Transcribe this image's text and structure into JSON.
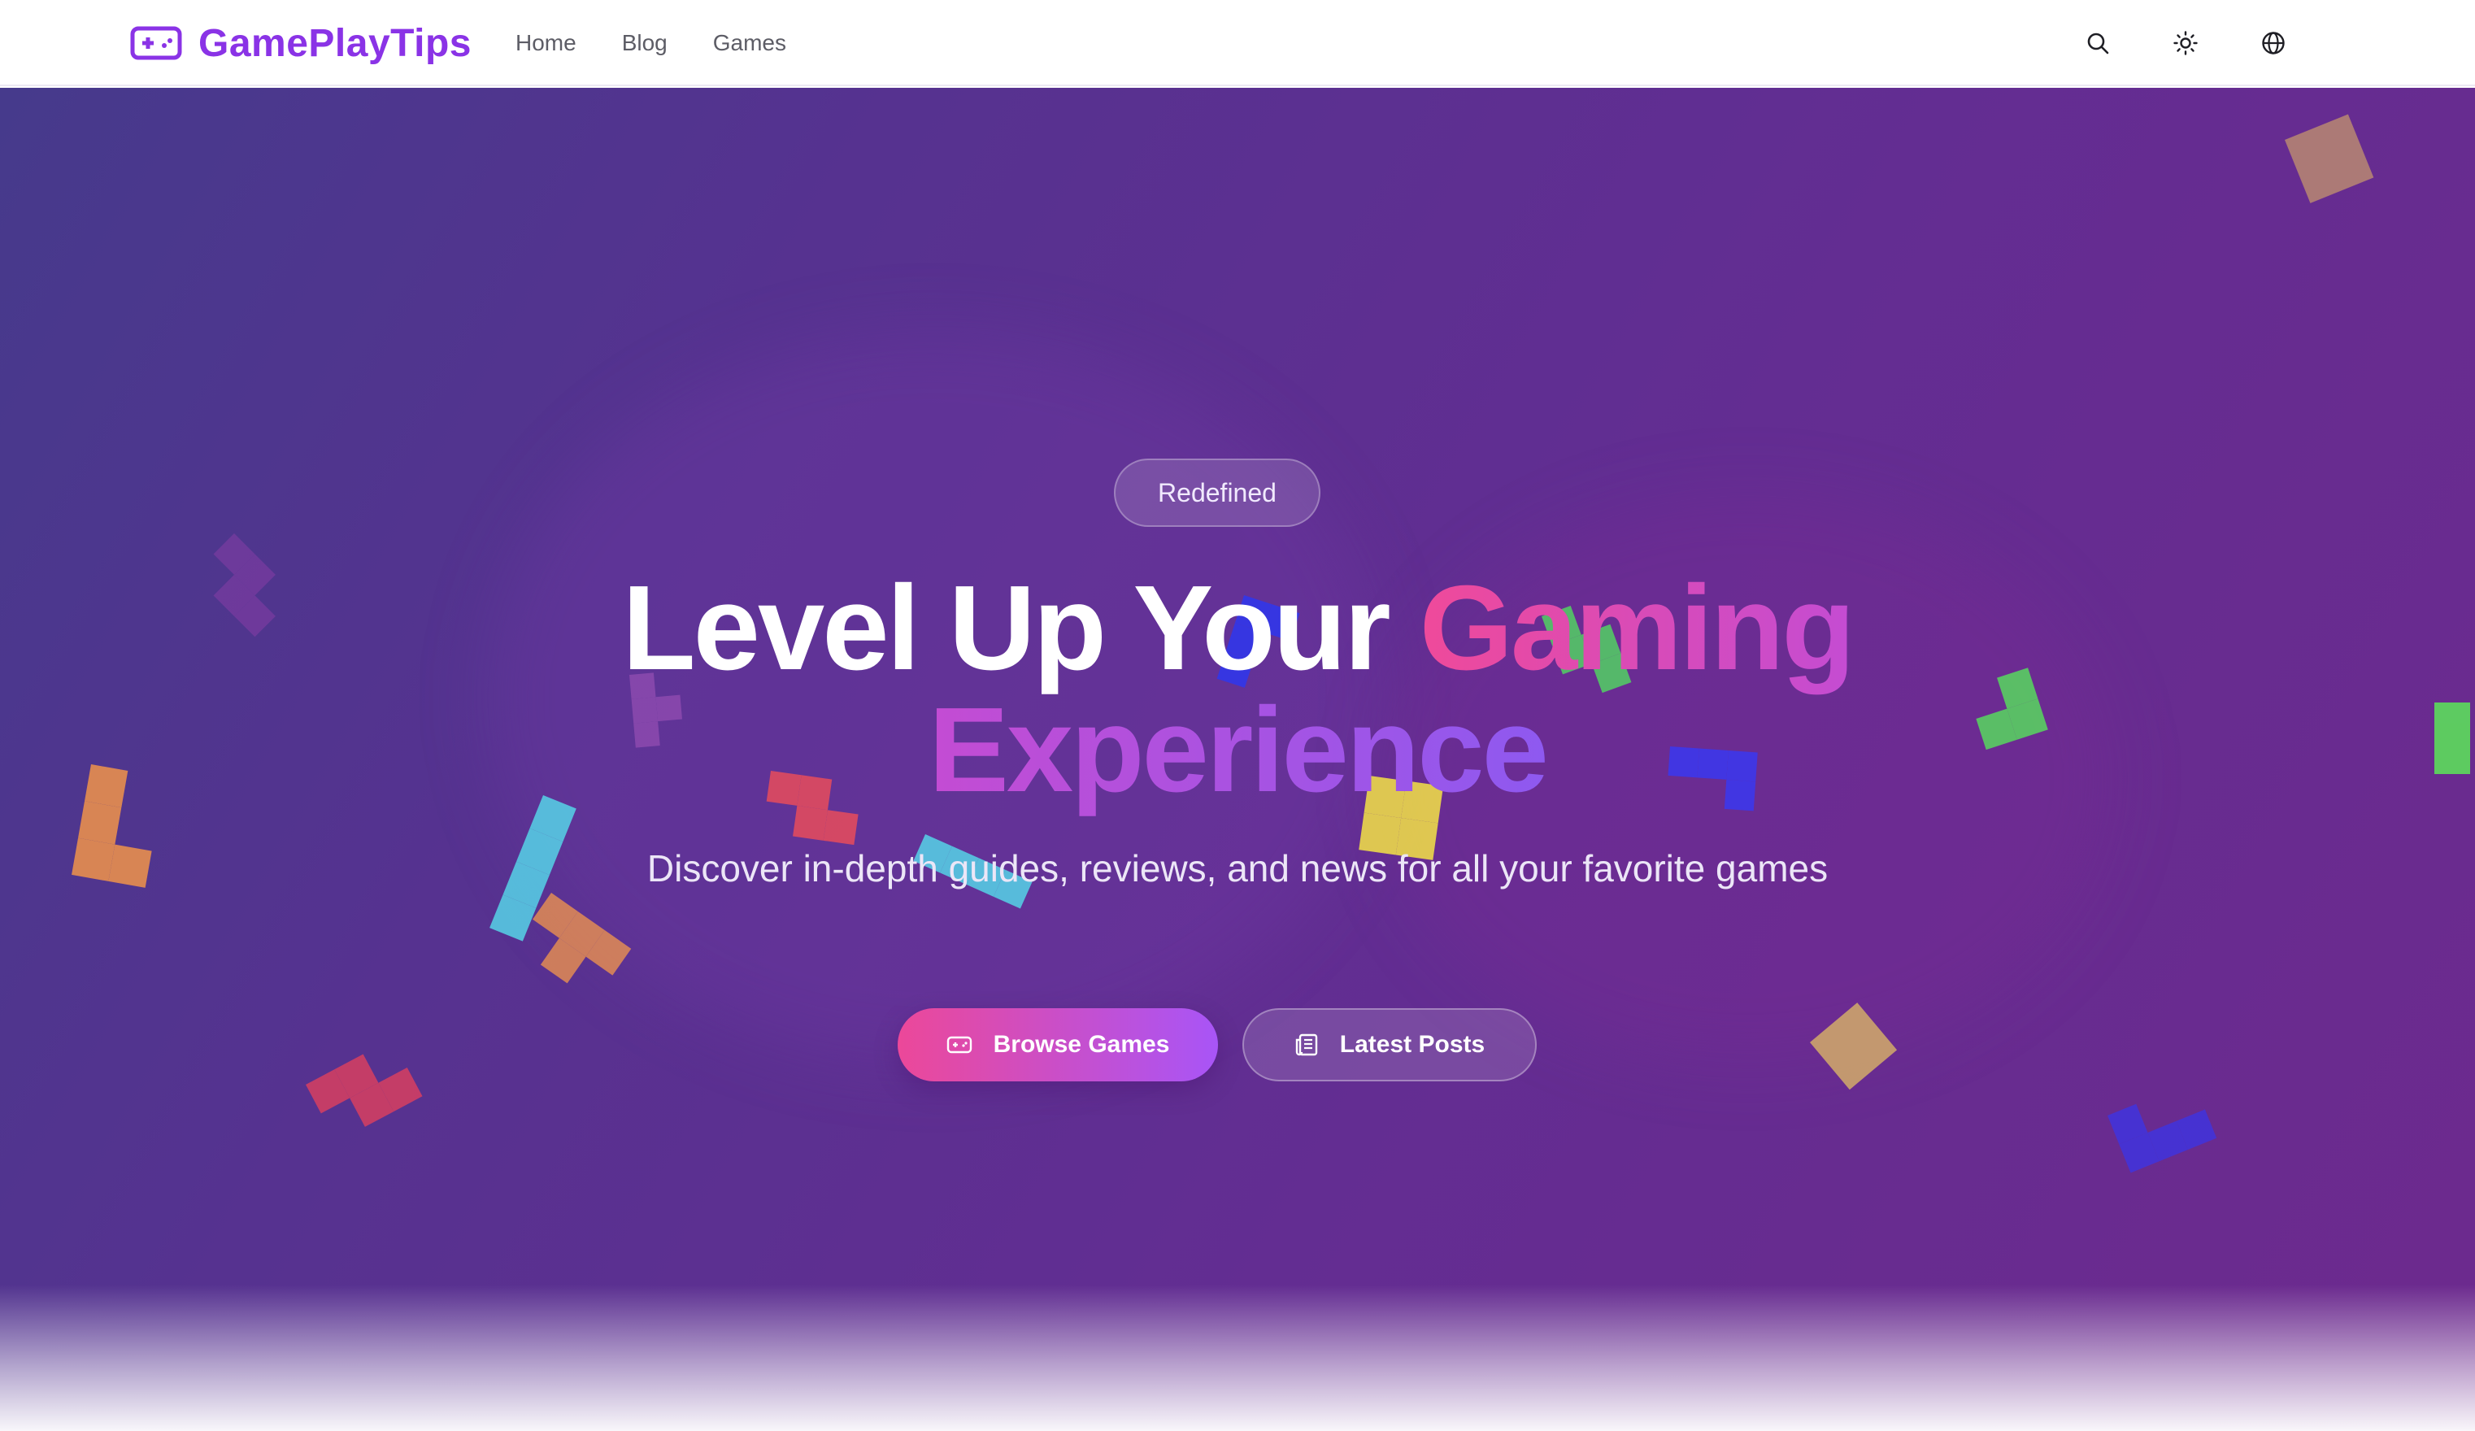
{
  "colors": {
    "brand": "#8a33e6",
    "hero_start": "#463a8c",
    "hero_end": "#6d2a8e",
    "accent_pink": "#ec4899",
    "accent_purple": "#a855f7"
  },
  "header": {
    "brand_name": "GamePlayTips",
    "brand_icon": "gamepad-icon",
    "nav": [
      {
        "label": "Home"
      },
      {
        "label": "Blog"
      },
      {
        "label": "Games"
      }
    ],
    "actions": [
      {
        "icon": "search-icon"
      },
      {
        "icon": "sun-icon"
      },
      {
        "icon": "globe-icon"
      }
    ]
  },
  "hero": {
    "badge": "Redefined",
    "title_part1": "Level Up Your ",
    "title_part2": "Gaming",
    "title_part3": "Experience",
    "subtitle": "Discover in-depth guides, reviews, and news for all your favorite games",
    "primary_button": {
      "label": "Browse Games",
      "icon": "gamepad-icon"
    },
    "secondary_button": {
      "label": "Latest Posts",
      "icon": "newspaper-icon"
    }
  }
}
